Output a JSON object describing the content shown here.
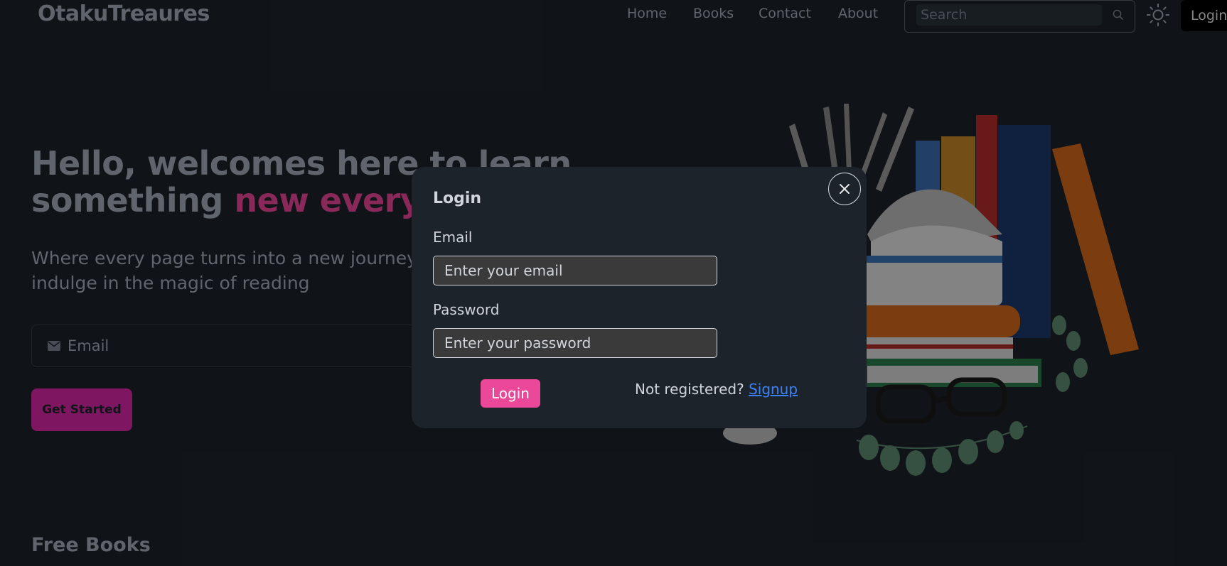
{
  "nav": {
    "brand": "OtakuTreaures",
    "links": [
      "Home",
      "Books",
      "Contact",
      "About"
    ],
    "search_placeholder": "Search",
    "login_label": "Login"
  },
  "hero": {
    "title_line1": "Hello, welcomes here to learn",
    "title_line2_prefix": "something ",
    "title_line2_accent": "new everyday!!!",
    "subtitle_line1": "Where every page turns into a new journey.",
    "subtitle_line2": "indulge in the magic of reading",
    "email_placeholder": "Email",
    "cta_label": "Get Started"
  },
  "section": {
    "free_books_heading": "Free Books"
  },
  "modal": {
    "title": "Login",
    "email_label": "Email",
    "email_placeholder": "Enter your email",
    "password_label": "Password",
    "password_placeholder": "Enter your password",
    "submit_label": "Login",
    "not_registered": "Not registered?",
    "signup_label": "Signup"
  },
  "colors": {
    "background": "#1d232a",
    "accent_pink": "#ec4899",
    "cta_magenta": "#d926a9",
    "link_blue": "#3b82f6"
  },
  "icons": [
    "search-icon",
    "sun-icon",
    "mail-icon",
    "close-icon"
  ]
}
